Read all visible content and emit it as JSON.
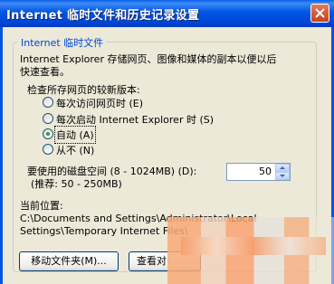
{
  "window": {
    "title": "Internet 临时文件和历史记录设置"
  },
  "group": {
    "title": "Internet 临时文件",
    "description_line1": "Internet Explorer 存储网页、图像和媒体的副本以便以后",
    "description_line2": "快速查看。",
    "check_label": "检查所存网页的较新版本:",
    "options": [
      {
        "label": "每次访问网页时 (E)",
        "selected": false
      },
      {
        "label": "每次启动 Internet Explorer 时 (S)",
        "selected": false
      },
      {
        "label": "自动 (A)",
        "selected": true
      },
      {
        "label": "从不 (N)",
        "selected": false
      }
    ],
    "disk_label_line1": "要使用的磁盘空间 (8 - 1024MB) (D):",
    "disk_label_line2": "(推荐: 50 - 250MB)",
    "disk_value": "50",
    "location_label": "当前位置:",
    "location_line1": "C:\\Documents and Settings\\Administrator\\Local",
    "location_line2": "Settings\\Temporary Internet Files\\"
  },
  "buttons": {
    "move_folder": "移动文件夹(M)...",
    "view_objects": "查看对"
  },
  "colors": {
    "title_bar": "#0055E5",
    "group_title": "#0046D5",
    "face": "#ECE9D8"
  }
}
